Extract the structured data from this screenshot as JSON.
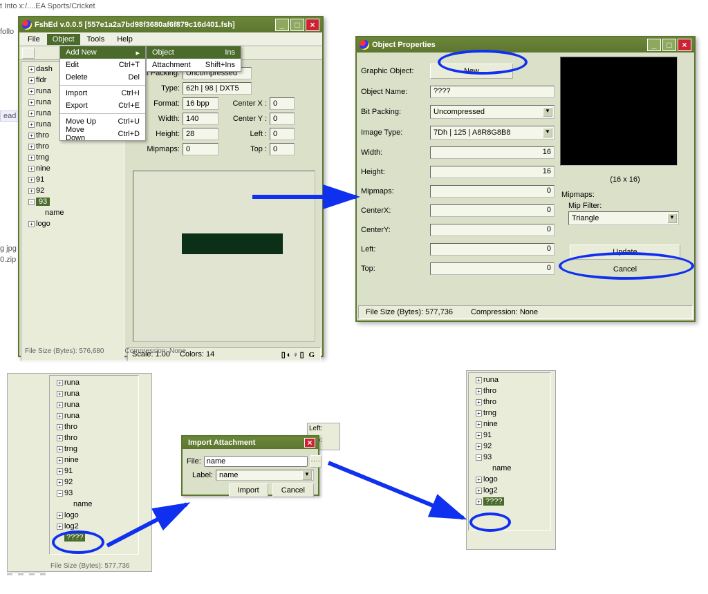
{
  "bg": {
    "t1": "t Into x:/....EA Sports/Cricket",
    "follo": "follo",
    "ead": "ead",
    "jpg": "g jpg",
    "zip": "0.zip"
  },
  "win1": {
    "title": "FshEd v.0.0.5 [557e1a2a7bd98f3680af6f879c16d401.fsh]",
    "menus": {
      "file": "File",
      "object": "Object",
      "tools": "Tools",
      "help": "Help"
    },
    "objmenu": {
      "addnew": "Add New",
      "edit": "Edit",
      "edit_sc": "Ctrl+T",
      "delete": "Delete",
      "delete_sc": "Del",
      "import": "Import",
      "import_sc": "Ctrl+I",
      "export": "Export",
      "export_sc": "Ctrl+E",
      "mup": "Move Up",
      "mup_sc": "Ctrl+U",
      "mdown": "Move Down",
      "mdown_sc": "Ctrl+D"
    },
    "submenu": {
      "object": "Object",
      "object_sc": "Ins",
      "attach": "Attachment",
      "attach_sc": "Shift+Ins"
    },
    "tree": [
      "dash",
      "fldr",
      "runa",
      "runa",
      "runa",
      "runa",
      "thro",
      "thro",
      "trng",
      "nine",
      "91",
      "92",
      "93",
      "name",
      "logo"
    ],
    "props": {
      "bitpack_l": "it Packing:",
      "bitpack_v": "Uncompressed",
      "type_l": "Type:",
      "type_v": "62h | 98 | DXT5",
      "format_l": "Format:",
      "format_v": "16 bpp",
      "width_l": "Width:",
      "width_v": "140",
      "height_l": "Height:",
      "height_v": "28",
      "mip_l": "Mipmaps:",
      "mip_v": "0",
      "cx_l": "Center X :",
      "cx_v": "0",
      "cy_l": "Center Y :",
      "cy_v": "0",
      "left_l": "Left :",
      "left_v": "0",
      "top_l": "Top :",
      "top_v": "0"
    },
    "status": {
      "scale": "Scale: 1.00",
      "colors": "Colors: 14"
    },
    "foot": {
      "fs": "File Size (Bytes):   576,680",
      "comp": "Compression: None"
    }
  },
  "win2": {
    "title": "Object Properties",
    "gobj": "Graphic Object:",
    "new": "New",
    "oname_l": "Object Name:",
    "oname_v": "????",
    "bp_l": "Bit Packing:",
    "bp_v": "Uncompressed",
    "it_l": "Image Type:",
    "it_v": "7Dh | 125 | A8R8G8B8",
    "w_l": "Width:",
    "w_v": "16",
    "h_l": "Height:",
    "h_v": "16",
    "mip_l": "Mipmaps:",
    "mip_v": "0",
    "cx_l": "CenterX:",
    "cx_v": "0",
    "cy_l": "CenterY:",
    "cy_v": "0",
    "left_l": "Left:",
    "left_v": "0",
    "top_l": "Top:",
    "top_v": "0",
    "dims": "(16 x 16)",
    "mipmaps": "Mipmaps:",
    "mipfilter": "Mip Filter:",
    "mipfilter_v": "Triangle",
    "update": "Update",
    "cancel": "Cancel",
    "status": {
      "fs": "File Size (Bytes):   577,736",
      "comp": "Compression: None"
    }
  },
  "tree2": [
    "runa",
    "runa",
    "runa",
    "runa",
    "thro",
    "thro",
    "trng",
    "nine",
    "91",
    "92",
    "93",
    "name",
    "logo",
    "log2",
    "????"
  ],
  "tree2a": [
    "runa",
    "runa",
    "runa",
    "runa",
    "thro",
    "thro",
    "trng",
    "nine",
    "91",
    "92",
    "93"
  ],
  "tree2b": "name",
  "tree2c": "logo",
  "tree2d": "log2",
  "tree2e": "????",
  "tree3": [
    "runa",
    "thro",
    "thro",
    "trng",
    "nine",
    "91",
    "92",
    "93"
  ],
  "tree3b": "name",
  "tree3c": "logo",
  "tree3d": "log2",
  "tree3e": "????",
  "dlg": {
    "title": "Import Attachment",
    "file_l": "File:",
    "file_v": "name",
    "label_l": "Label:",
    "label_v": "name",
    "import": "Import",
    "cancel": "Cancel"
  },
  "bp2_labels": {
    "left": "Left:",
    "top": "Top:"
  },
  "botfoot": "File Size (Bytes):   577,736"
}
